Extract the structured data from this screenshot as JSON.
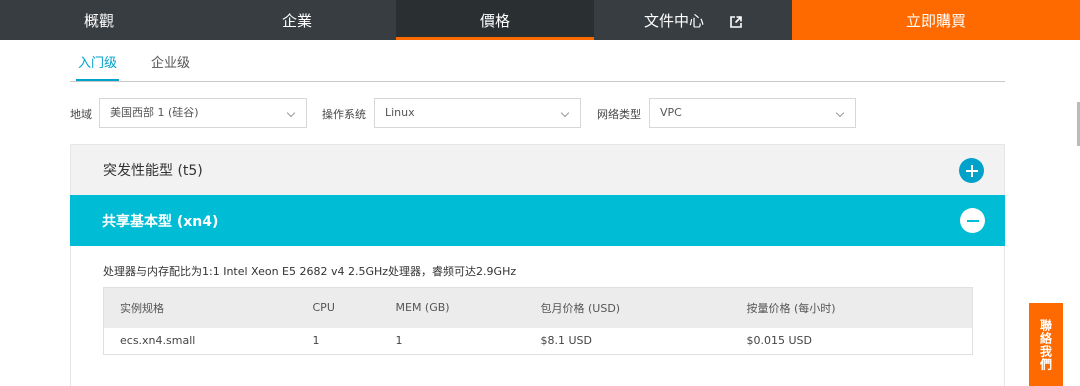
{
  "nav": {
    "overview": "概觀",
    "enterprise": "企業",
    "pricing": "價格",
    "docs": "文件中心",
    "docs_icon": "external-link-icon",
    "buy": "立即購買"
  },
  "tabs": {
    "entry": "入门级",
    "enterprise": "企业级",
    "active": "入门级"
  },
  "filters": {
    "region_label": "地域",
    "region_value": "美国西部 1 (硅谷)",
    "os_label": "操作系统",
    "os_value": "Linux",
    "network_label": "网络类型",
    "network_value": "VPC"
  },
  "panels": {
    "t5": {
      "title": "突发性能型 (t5)",
      "icon": "plus-circle-icon",
      "expanded": false
    },
    "xn4": {
      "title": "共享基本型 (xn4)",
      "icon": "minus-circle-icon",
      "expanded": true,
      "description": "处理器与内存配比为1:1 Intel Xeon E5 2682 v4 2.5GHz处理器，睿频可达2.9GHz",
      "table": {
        "headers": [
          "实例规格",
          "CPU",
          "MEM (GB)",
          "包月价格 (USD)",
          "按量价格 (每小时)"
        ],
        "rows": [
          [
            "ecs.xn4.small",
            "1",
            "1",
            "$8.1 USD",
            "$0.015 USD"
          ]
        ]
      }
    }
  },
  "contact_button": "聯絡我們",
  "colors": {
    "nav_bg": "#373d41",
    "accent_orange": "#ff6a00",
    "accent_cyan": "#00bcd4",
    "link_blue": "#00a2ca"
  }
}
